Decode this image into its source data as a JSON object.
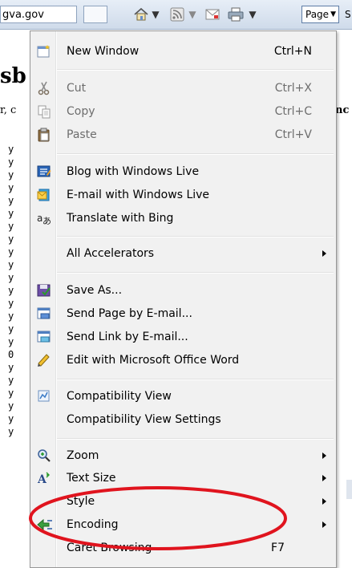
{
  "browser": {
    "address_fragment": "gva.gov",
    "page_button": "Page",
    "safety_stub": "S"
  },
  "background": {
    "heading_fragment": "sb",
    "sub_fragment": "r, c",
    "sub_right_fragment": "nc",
    "column_chars": [
      "y",
      "y",
      "y",
      "y",
      "y",
      "y",
      "y",
      "y",
      "y",
      "y",
      "y",
      "y",
      "y",
      "y",
      "y",
      "y",
      "0",
      "y",
      "y",
      "y",
      "y",
      "y",
      "y"
    ]
  },
  "menu": {
    "items": [
      {
        "id": "new-window",
        "label": "New Window",
        "shortcut": "Ctrl+N",
        "icon": "new-window-icon",
        "enabled": true
      },
      {
        "id": "cut",
        "label": "Cut",
        "shortcut": "Ctrl+X",
        "icon": "scissors-icon",
        "enabled": false
      },
      {
        "id": "copy",
        "label": "Copy",
        "shortcut": "Ctrl+C",
        "icon": "copy-icon",
        "enabled": false
      },
      {
        "id": "paste",
        "label": "Paste",
        "shortcut": "Ctrl+V",
        "icon": "paste-icon",
        "enabled": false
      },
      {
        "id": "blog",
        "label": "Blog with Windows Live",
        "icon": "blog-icon",
        "enabled": true
      },
      {
        "id": "email-live",
        "label": "E-mail with Windows Live",
        "icon": "mail-live-icon",
        "enabled": true
      },
      {
        "id": "translate",
        "label": "Translate with Bing",
        "icon": "translate-icon",
        "enabled": true
      },
      {
        "id": "all-accelerators",
        "label": "All Accelerators",
        "submenu": true,
        "enabled": true
      },
      {
        "id": "save-as",
        "label": "Save As...",
        "icon": "save-icon",
        "enabled": true
      },
      {
        "id": "send-page",
        "label": "Send Page by E-mail...",
        "icon": "send-page-icon",
        "enabled": true
      },
      {
        "id": "send-link",
        "label": "Send Link by E-mail...",
        "icon": "send-link-icon",
        "enabled": true
      },
      {
        "id": "edit-word",
        "label": "Edit with Microsoft Office Word",
        "icon": "pencil-icon",
        "enabled": true
      },
      {
        "id": "compat-view",
        "label": "Compatibility View",
        "icon": "compatibility-icon",
        "enabled": true
      },
      {
        "id": "compat-settings",
        "label": "Compatibility View Settings",
        "enabled": true
      },
      {
        "id": "zoom",
        "label": "Zoom",
        "icon": "zoom-icon",
        "submenu": true,
        "enabled": true
      },
      {
        "id": "text-size",
        "label": "Text Size",
        "icon": "text-size-icon",
        "submenu": true,
        "enabled": true
      },
      {
        "id": "style",
        "label": "Style",
        "submenu": true,
        "enabled": true
      },
      {
        "id": "encoding",
        "label": "Encoding",
        "icon": "encoding-icon",
        "submenu": true,
        "enabled": true
      },
      {
        "id": "caret-browsing",
        "label": "Caret Browsing",
        "shortcut": "F7",
        "enabled": true
      }
    ]
  },
  "annotation": {
    "oval_color": "#e0141e"
  }
}
